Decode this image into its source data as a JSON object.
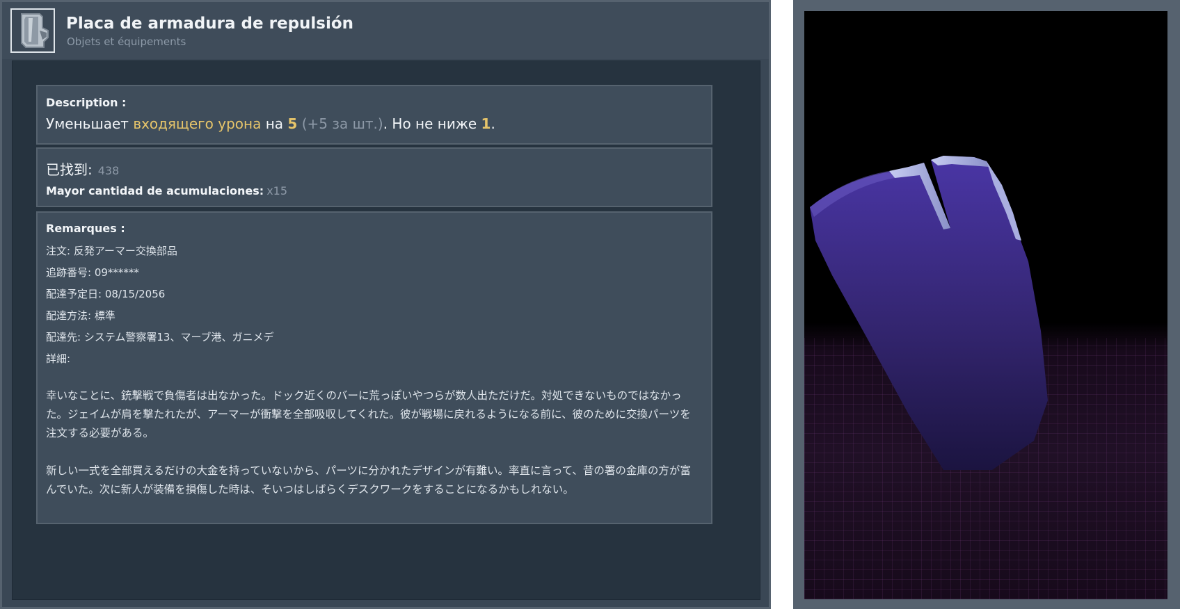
{
  "header": {
    "icon": "armor-plate-icon",
    "title": "Placa de armadura de repulsión",
    "subtitle": "Objets et équipements"
  },
  "description": {
    "label": "Description :",
    "text_before": "Уменьшает ",
    "highlight": "входящего урона",
    "text_mid": " на ",
    "amount": "5",
    "stack_note": " (+5 за шт.)",
    "text_after": ". Но не ниже ",
    "minimum": "1",
    "end": "."
  },
  "stats": {
    "found_label": "已找到:",
    "found_value": "438",
    "stack_label": "Mayor cantidad de acumulaciones:",
    "stack_value": "x15"
  },
  "remarks": {
    "label": "Remarques :",
    "lines": [
      "注文: 反発アーマー交換部品",
      "追跡番号: 09******",
      "配達予定日: 08/15/2056",
      "配達方法: 標準",
      "配達先: システム警察署13、マーブ港、ガニメデ",
      "詳細:"
    ],
    "paragraphs": [
      "幸いなことに、銃撃戦で負傷者は出なかった。ドック近くのバーに荒っぽいやつらが数人出ただけだ。対処できないものではなかった。ジェイムが肩を撃たれたが、アーマーが衝撃を全部吸収してくれた。彼が戦場に戻れるようになる前に、彼のために交換パーツを注文する必要がある。",
      "新しい一式を全部買えるだけの大金を持っていないから、パーツに分かれたデザインが有難い。率直に言って、昔の署の金庫の方が富んでいた。次に新人が装備を損傷した時は、そいつはしばらくデスクワークをすることになるかもしれない。"
    ]
  },
  "model_viewer": {
    "object_color": "#3b2a7a"
  }
}
